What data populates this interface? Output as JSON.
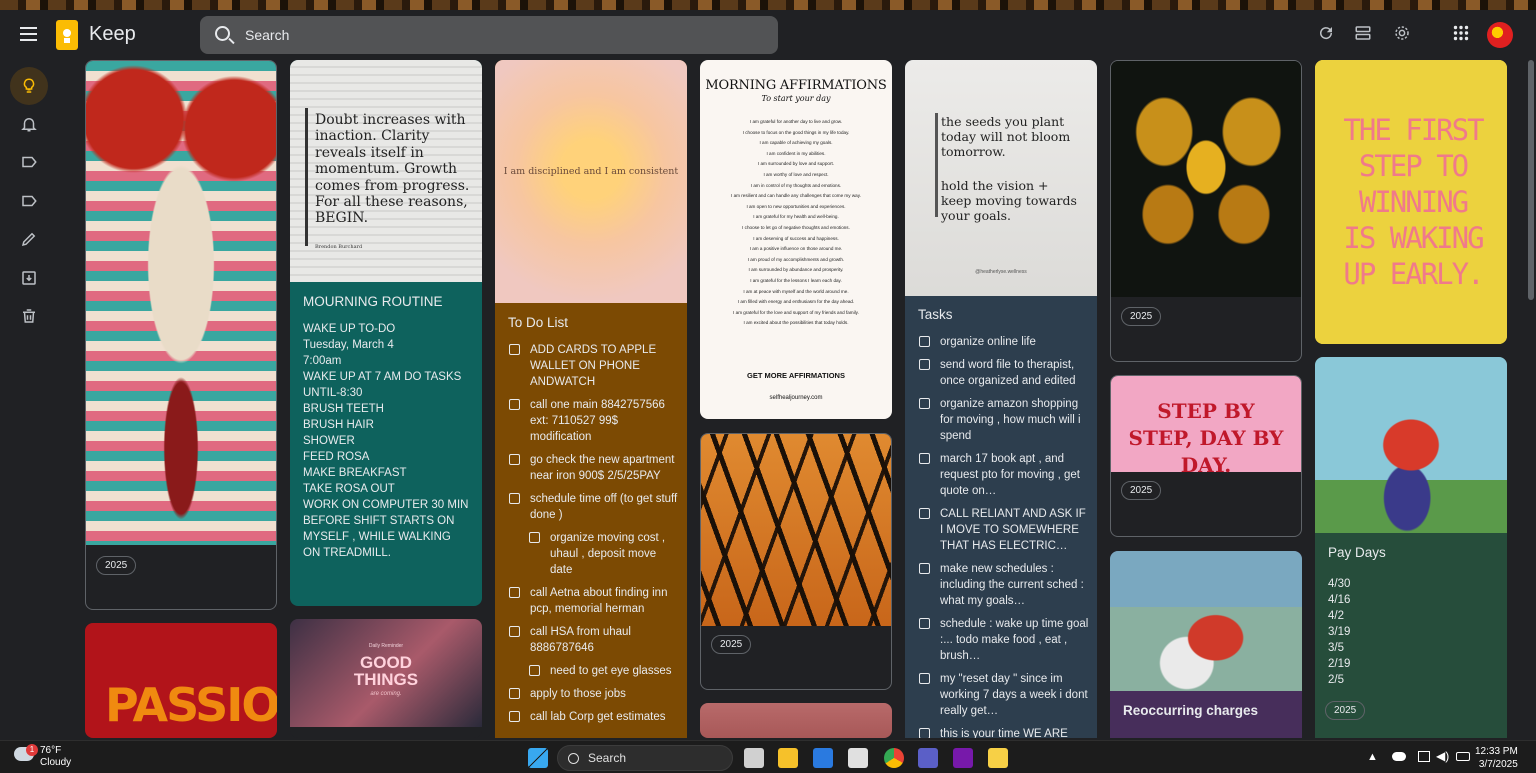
{
  "app": {
    "title": "Keep"
  },
  "search": {
    "placeholder": "Search"
  },
  "notes": {
    "n_routine": {
      "image_quote": "Doubt increases with inaction. Clarity reveals itself in momentum. Growth comes from progress. For all these reasons, BEGIN.",
      "image_author": "Brendon Burchard",
      "title": "MOURNING ROUTINE",
      "body": "WAKE UP TO-DO\nTuesday, March 4\n7:00am\nWAKE UP AT 7 AM                DO TASKS UNTIL-8:30\nBRUSH TEETH\nBRUSH HAIR\nSHOWER\nFEED ROSA\nMAKE BREAKFAST\nTAKE ROSA OUT\nWORK ON COMPUTER 30 MIN BEFORE SHIFT STARTS ON MYSELF , WHILE WALKING ON TREADMILL."
    },
    "n_todo": {
      "image_text": "I am disciplined and I am consistent",
      "title": "To Do List",
      "items": [
        {
          "text": "ADD CARDS TO APPLE WALLET ON PHONE ANDWATCH",
          "sub": false
        },
        {
          "text": "call one main 8842757566 ext: 7110527 99$ modification",
          "sub": false
        },
        {
          "text": "go check the new apartment near iron 900$ 2/5/25PAY",
          "sub": false
        },
        {
          "text": "schedule time off (to get stuff done )",
          "sub": false
        },
        {
          "text": "organize moving cost , uhaul , deposit move date",
          "sub": true
        },
        {
          "text": "call Aetna about finding inn pcp, memorial herman",
          "sub": false
        },
        {
          "text": "call HSA from uhaul 8886787646",
          "sub": false
        },
        {
          "text": "need to get eye glasses",
          "sub": true
        },
        {
          "text": "apply to those jobs",
          "sub": false
        },
        {
          "text": "call lab Corp get estimates",
          "sub": false
        }
      ]
    },
    "n_affirm": {
      "heading": "MORNING AFFIRMATIONS",
      "subheading": "To start your day",
      "lines": [
        "I am grateful for another day to live and grow.",
        "I choose to focus on the good things in my life today.",
        "I am capable of achieving my goals.",
        "I am confident in my abilities.",
        "I am surrounded by love and support.",
        "I am worthy of love and respect.",
        "I am in control of my thoughts and emotions.",
        "I am resilient and can handle any challenges that come my way.",
        "I am open to new opportunities and experiences.",
        "I am grateful for my health and well-being.",
        "I choose to let go of negative thoughts and emotions.",
        "I am deserving of success and happiness.",
        "I am a positive influence on those around me.",
        "I am proud of my accomplishments and growth.",
        "I am surrounded by abundance and prosperity.",
        "I am grateful for the lessons I learn each day.",
        "I am at peace with myself and the world around me.",
        "I am filled with energy and enthusiasm for the day ahead.",
        "I am grateful for the love and support of my friends and family.",
        "I am excited about the possibilities that today holds."
      ],
      "cta": "GET MORE AFFIRMATIONS",
      "url": "selfhealjourney.com"
    },
    "n_tasks": {
      "image_text_1": "the seeds you plant today will not bloom tomorrow.",
      "image_text_2": "hold the vision + keep moving towards your goals.",
      "image_credit": "@heatherlyse.wellness",
      "title": "Tasks",
      "items": [
        "organize online life",
        "send word file to therapist, once organized and edited",
        "organize amazon shopping for moving , how much will i spend",
        "march 17 book apt , and request pto for moving , get quote on…",
        "CALL RELIANT AND ASK IF I MOVE TO SOMEWHERE THAT HAS ELECTRIC…",
        "make new schedules : including the current sched : what my goals…",
        " schedule : wake up time goal :... todo make food , eat , brush…",
        "my \"reset day \" since im working 7 days a week i dont really get…",
        "this is your time WE ARE"
      ]
    },
    "n_stepbystep": {
      "image_text": "STEP BY STEP, DAY BY DAY."
    },
    "n_firststep": {
      "image_text": "THE FIRST STEP TO WINNING IS WAKING UP EARLY."
    },
    "n_paydays": {
      "title": "Pay Days",
      "body": "4/30\n4/16\n4/2\n3/19\n3/5\n2/19\n2/5"
    },
    "n_recurring": {
      "title": "Reoccurring charges"
    },
    "n_passion": {
      "image_text": "PASSION"
    },
    "n_goodthings": {
      "image_small": "Daily Reminder",
      "image_big": "GOOD THINGS",
      "image_sub": "are coming."
    }
  },
  "chip_label": "2025",
  "taskbar": {
    "weather_temp": "76°F",
    "weather_desc": "Cloudy",
    "weather_badge": "1",
    "search_label": "Search",
    "time": "12:33 PM",
    "date": "3/7/2025"
  },
  "colors": {
    "teal": "#0e625d",
    "brown": "#7c4a03",
    "slate": "#2d3e4e",
    "purple": "#472e5b",
    "green": "#264d3b",
    "accent": "#fbbc04"
  }
}
